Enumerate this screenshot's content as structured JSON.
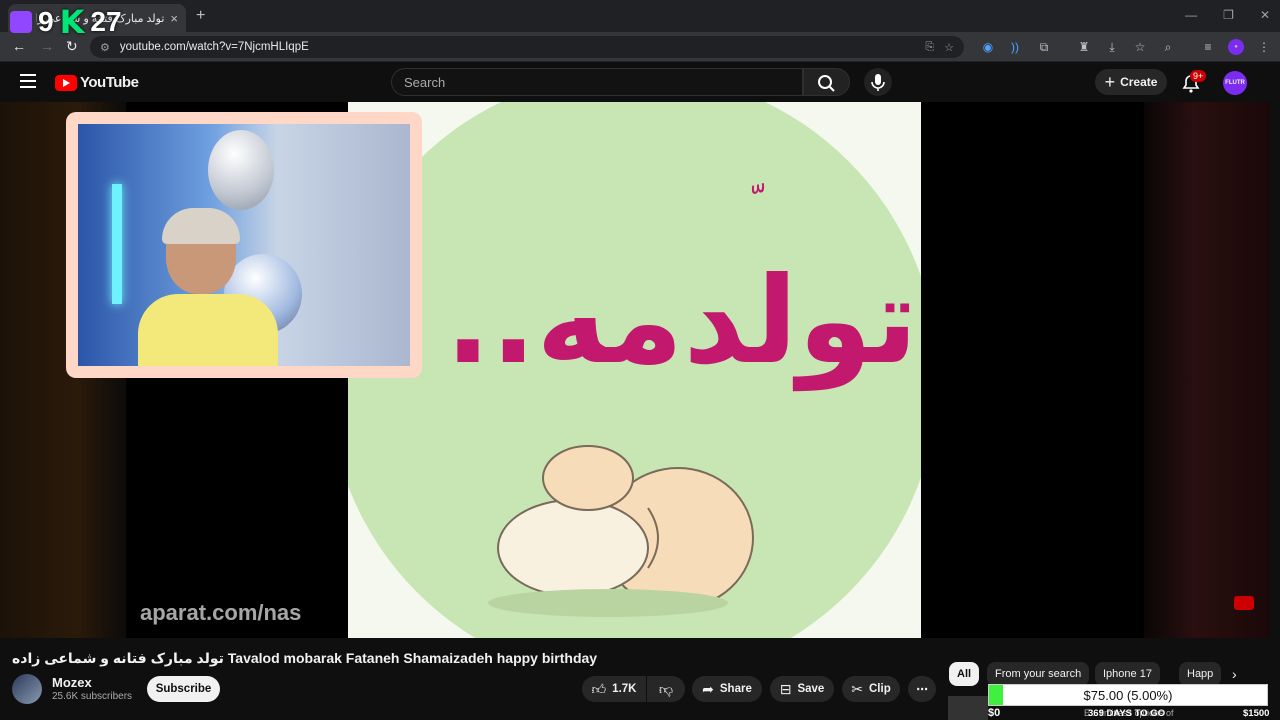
{
  "browser": {
    "tab_title": "تولد مبارک فتانه و شماعی زاده",
    "tab_close": "×",
    "new_tab": "+",
    "url": "youtube.com/watch?v=7NjcmHLIqpE",
    "window_controls": [
      "—",
      "❐",
      "✕"
    ]
  },
  "overlay_counter": {
    "left": "9",
    "k": "K",
    "right": "27"
  },
  "youtube": {
    "logo_text": "YouTube",
    "search_placeholder": "Search",
    "create_label": "Create",
    "notifications_badge": "9+",
    "avatar_text": "FLUTR"
  },
  "video": {
    "overlay_persian_main": "تولدمه..",
    "overlay_persian_top": "ّ",
    "watermark": "aparat.com/nas",
    "title": "تولد مبارک فتانه و شماعی زاده Tavalod mobarak Fataneh Shamaizadeh happy birthday",
    "channel_name": "Mozex",
    "subscribers": "25.6K subscribers",
    "subscribe_label": "Subscribe",
    "likes": "1.7K",
    "share_label": "Share",
    "save_label": "Save",
    "clip_label": "Clip",
    "more_label": "⋯"
  },
  "chips": [
    "All",
    "From your search",
    "Iphone 17",
    "Happ"
  ],
  "chips_next": "›",
  "donation": {
    "goal_text": "$75.00 (5.00%)",
    "progress_fraction": 0.05,
    "left_amount": "$0",
    "days_to_go": "369 DAYS TO GO",
    "ticker": "E... limitless options of",
    "right_amount": "$1500"
  },
  "colors": {
    "youtube_red": "#ff0000",
    "goal_fill": "#3ff03f",
    "accent_magenta": "#c2186e"
  }
}
